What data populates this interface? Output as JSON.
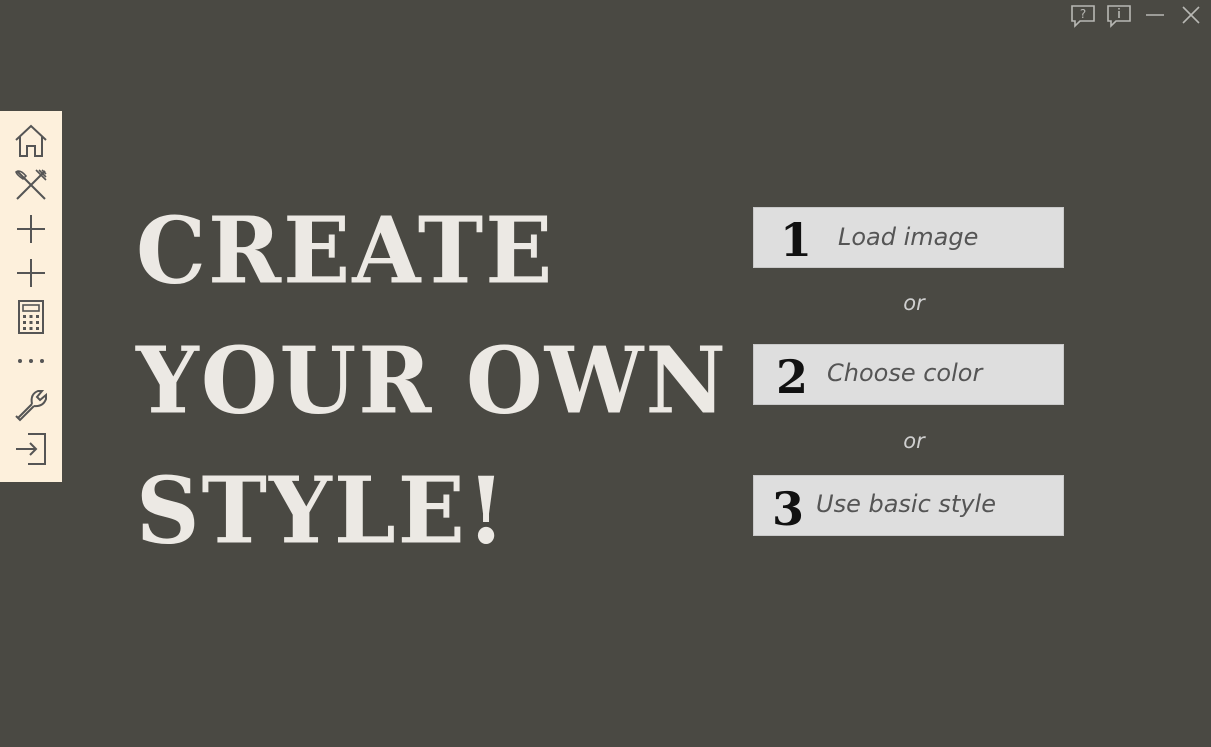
{
  "window_controls": {
    "help_icon": "help-question-icon",
    "info_icon": "info-icon",
    "minimize_icon": "minimize-icon",
    "close_icon": "close-icon"
  },
  "sidebar": {
    "background": "#fdf0dc",
    "items": [
      {
        "name": "home",
        "icon": "home-icon"
      },
      {
        "name": "menu",
        "icon": "fork-knife-icon"
      },
      {
        "name": "add-1",
        "icon": "plus-icon"
      },
      {
        "name": "add-2",
        "icon": "plus-icon"
      },
      {
        "name": "calculator",
        "icon": "calculator-icon"
      },
      {
        "name": "more",
        "icon": "more-dots-icon"
      },
      {
        "name": "settings",
        "icon": "wrench-icon"
      },
      {
        "name": "logout",
        "icon": "sign-out-icon"
      }
    ]
  },
  "headline": {
    "line1": "CREATE",
    "line2": "YOUR OWN",
    "line3": "STYLE!"
  },
  "options": [
    {
      "number": "1",
      "label": "Load image"
    },
    {
      "number": "2",
      "label": "Choose color"
    },
    {
      "number": "3",
      "label": "Use basic style"
    }
  ],
  "separator": "or",
  "colors": {
    "background": "#4a4943",
    "headline": "#ece9e4",
    "option_bg": "#dedede"
  }
}
